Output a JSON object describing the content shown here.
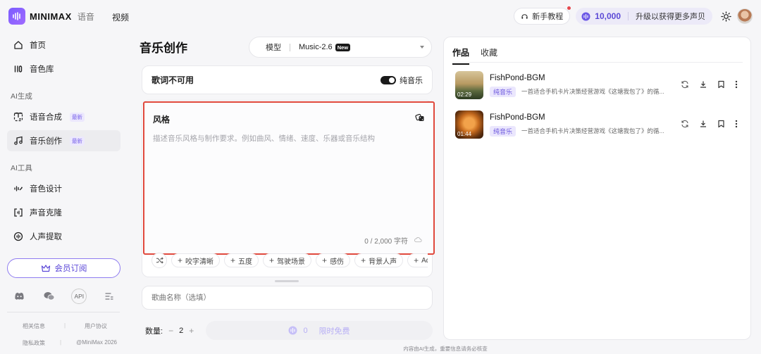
{
  "app": {
    "brand": "MINIMAX",
    "brand_sub": "语音",
    "nav_video": "视频",
    "tutorial": "新手教程",
    "credits": "10,000",
    "upgrade": "升级以获得更多声贝"
  },
  "sidebar": {
    "home": "首页",
    "voice_library": "音色库",
    "section_ai_gen": "AI生成",
    "tts": "语音合成",
    "tts_badge": "最新",
    "music": "音乐创作",
    "music_badge": "最新",
    "section_ai_tools": "AI工具",
    "voice_design": "音色设计",
    "voice_clone": "声音克隆",
    "vocal_extract": "人声提取",
    "vip": "会员订阅",
    "api": "API",
    "links": [
      "相关信息",
      "用户协议",
      "隐私政策",
      "@MiniMax 2026"
    ]
  },
  "main": {
    "title": "音乐创作",
    "model_label": "模型",
    "model_value": "Music-2.6",
    "model_tag": "New",
    "lyrics_label": "歌词不可用",
    "pure_music": "纯音乐",
    "style_title": "风格",
    "style_placeholder": "描述音乐风格与制作要求。例如曲风、情绪、速度、乐器或音乐结构",
    "char_count": "0 / 2,000 字符",
    "tags": [
      "咬字清晰",
      "五度",
      "驾驶场景",
      "感伤",
      "背景人声",
      "Ad-"
    ],
    "name_placeholder": "歌曲名称（选填）",
    "qty_label": "数量:",
    "qty_value": "2",
    "gen_count": "0",
    "gen_label": "限时免费",
    "footer_note": "内容由AI生成，重要信息请务必核查"
  },
  "works": {
    "tabs": [
      "作品",
      "收藏"
    ],
    "items": [
      {
        "title": "FishPond-BGM",
        "tag": "纯音乐",
        "desc": "一首适合手机卡片决策经营游戏《这塘我包了》的循...",
        "duration": "02:29"
      },
      {
        "title": "FishPond-BGM",
        "tag": "纯音乐",
        "desc": "一首适合手机卡片决策经营游戏《这塘我包了》的循...",
        "duration": "01:44"
      }
    ]
  },
  "colors": {
    "accent": "#5b49d6",
    "highlight_border": "#e0483c"
  }
}
